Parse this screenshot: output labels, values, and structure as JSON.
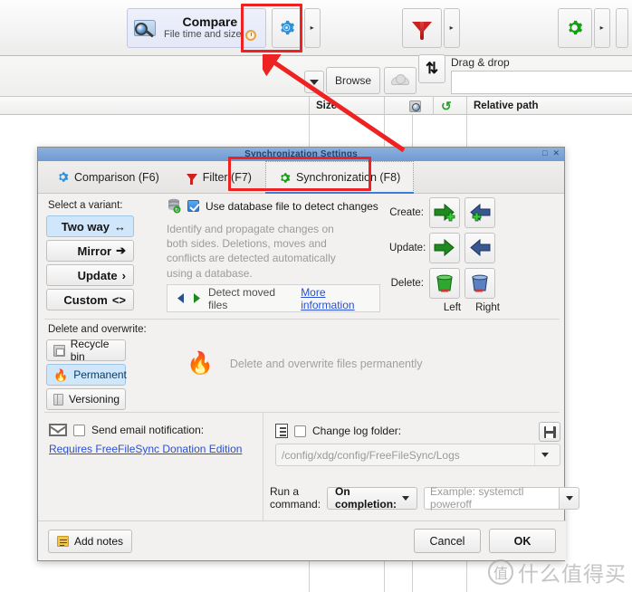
{
  "app": {
    "toolbar": {
      "compare_title": "Compare",
      "compare_subtitle": "File time and size",
      "compare_icon": "magnifier-folder-icon",
      "clock_icon": "stopwatch-icon",
      "comparison_settings_icon": "blue-gear-icon",
      "comparison_dropdown_caret": "▸",
      "filter_icon": "red-funnel-icon",
      "filter_dropdown_caret": "▸",
      "sync_settings_icon": "green-gear-icon",
      "sync_dropdown_caret": "▸"
    },
    "config_row": {
      "dropdown_caret": "▼",
      "browse_label": "Browse",
      "cloud_icon": "cloud-icon",
      "swap_icon": "⇅",
      "dragdrop_label": "Drag & drop",
      "dragdrop_value": ""
    },
    "grid_header": {
      "size_label": "Size",
      "preview_icon": "magnifier-icon",
      "sync_icon": "green-refresh-icon",
      "relative_path_label": "Relative path"
    }
  },
  "annotations": {
    "toolbar_highlight": "red-rectangle",
    "tab_highlight": "red-rectangle",
    "arrow": "red-arrow"
  },
  "dialog": {
    "title": "Synchronization Settings",
    "window_buttons": {
      "maximize": "□",
      "close": "✕"
    },
    "tabs": [
      {
        "label": "Comparison (F6)",
        "icon": "blue-gear-icon",
        "active": false
      },
      {
        "label": "Filter (F7)",
        "icon": "red-funnel-icon",
        "active": false
      },
      {
        "label": "Synchronization (F8)",
        "icon": "green-gear-icon",
        "active": true
      }
    ],
    "variant": {
      "label": "Select a variant:",
      "options": [
        {
          "label": "Two way",
          "glyph": "↔",
          "selected": true
        },
        {
          "label": "Mirror",
          "glyph": "➔",
          "selected": false
        },
        {
          "label": "Update",
          "glyph": "›",
          "selected": false
        },
        {
          "label": "Custom",
          "glyph": "<>",
          "selected": false
        }
      ]
    },
    "database": {
      "icon": "database-sync-icon",
      "checkbox_label": "Use database file to detect changes",
      "checked": true,
      "description": "Identify and propagate changes on both sides. Deletions, moves and conflicts are detected automatically using a database."
    },
    "detect_moved": {
      "icon": "left-right-arrows-icon",
      "label": "Detect moved files",
      "link": "More information"
    },
    "actions": {
      "rows": [
        {
          "label": "Create:",
          "left_icon": "green-right-arrow-plus-icon",
          "right_icon": "blue-left-arrow-plus-icon"
        },
        {
          "label": "Update:",
          "left_icon": "green-right-arrow-icon",
          "right_icon": "blue-left-arrow-icon"
        },
        {
          "label": "Delete:",
          "left_icon": "green-trash-icon",
          "right_icon": "blue-trash-icon"
        }
      ],
      "footers": [
        "Left",
        "Right"
      ]
    },
    "delete_overwrite": {
      "label": "Delete and overwrite:",
      "options": [
        {
          "label": "Recycle bin",
          "icon": "recycle-bin-icon",
          "selected": false
        },
        {
          "label": "Permanent",
          "icon": "flame-icon",
          "selected": true
        },
        {
          "label": "Versioning",
          "icon": "versioning-icon",
          "selected": false
        }
      ],
      "description": "Delete and overwrite files permanently",
      "description_icon": "flame-icon"
    },
    "email": {
      "icon": "envelope-icon",
      "checkbox_label": "Send email notification:",
      "checked": false,
      "link": "Requires FreeFileSync Donation Edition"
    },
    "log_folder": {
      "icon": "log-list-icon",
      "checkbox_label": "Change log folder:",
      "checked": false,
      "path_placeholder": "/config/xdg/config/FreeFileSync/Logs",
      "save_icon": "save-icon",
      "dropdown_caret": "▼"
    },
    "run_command": {
      "label": "Run a command:",
      "trigger_value": "On completion:",
      "trigger_caret": "▼",
      "command_placeholder": "Example: systemctl poweroff",
      "command_value": "",
      "dropdown_caret": "▼"
    },
    "footer": {
      "notes_label": "Add notes",
      "notes_icon": "note-icon",
      "cancel_label": "Cancel",
      "ok_label": "OK"
    }
  },
  "watermark": {
    "mark": "值",
    "text": "什么值得买"
  },
  "colors": {
    "accent_blue": "#3a7fd5",
    "titlebar_blue": "#7ba3d6",
    "selection_blue": "#cfe6fb",
    "annotation_red": "#ee2222",
    "green": "#1f9c1f",
    "link_blue": "#2a4fd0"
  }
}
